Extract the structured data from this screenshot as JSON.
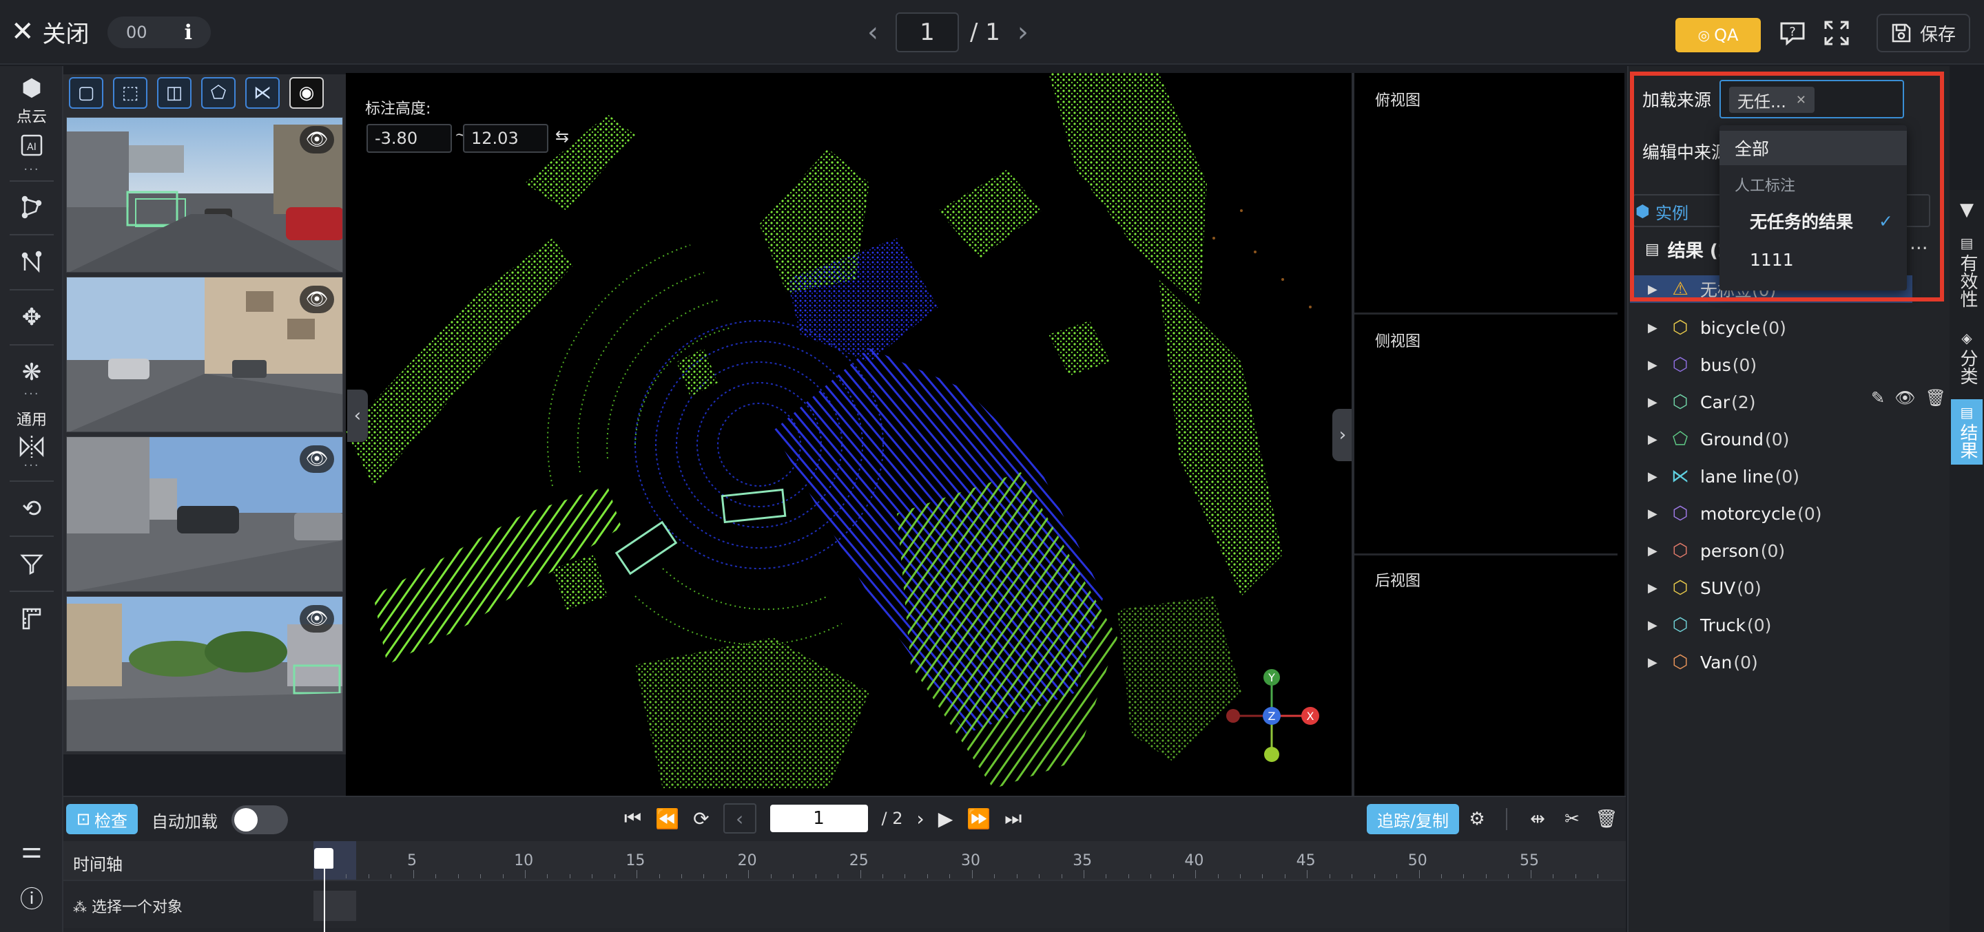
{
  "topbar": {
    "close_label": "关闭",
    "pill_count": "00",
    "page_current": "1",
    "page_total": "/ 1",
    "qa_label": "QA",
    "save_label": "保存"
  },
  "rail": {
    "section_pointcloud": "点云",
    "section_general": "通用"
  },
  "viewport": {
    "height_label": "标注高度:",
    "height_min": "-3.80",
    "height_sep": "~",
    "height_max": "12.03"
  },
  "axes": {
    "y": "Y",
    "z": "Z",
    "x": "X"
  },
  "sideviews": {
    "top": "俯视图",
    "side": "侧视图",
    "back": "后视图"
  },
  "timeline": {
    "check_label": "检查",
    "auto_load_label": "自动加载",
    "auto_load_on": false,
    "frame_current": "1",
    "frame_total": "/ 2",
    "track_copy_label": "追踪/复制",
    "axis_label": "时间轴",
    "ticks": [
      "5",
      "10",
      "15",
      "20",
      "25",
      "30",
      "35",
      "40",
      "45",
      "50",
      "55"
    ],
    "pick_object_label": "选择一个对象"
  },
  "rightpanel": {
    "load_source_label": "加载来源",
    "selected_tag": "无任...",
    "edit_source_label": "编辑中来源",
    "tab_instance": "实例",
    "result_header": "结果 (2",
    "warn_item": "无标签(0)",
    "dropdown": {
      "all": "全部",
      "group_manual": "人工标注",
      "no_task_result": "无任务的结果",
      "item_1111": "1111"
    },
    "tree": [
      {
        "name": "bicycle",
        "count": "(0)",
        "icon": "cuboid-icon",
        "color": "#e6c84a"
      },
      {
        "name": "bus",
        "count": "(0)",
        "icon": "cuboid-icon",
        "color": "#8f6fe0"
      },
      {
        "name": "Car",
        "count": "(2)",
        "icon": "cuboid-icon",
        "color": "#6fd3a6"
      },
      {
        "name": "Ground",
        "count": "(0)",
        "icon": "polygon-icon",
        "color": "#5fc986"
      },
      {
        "name": "lane line",
        "count": "(0)",
        "icon": "polyline-icon",
        "color": "#5fd0e0"
      },
      {
        "name": "motorcycle",
        "count": "(0)",
        "icon": "cuboid-icon",
        "color": "#a07ae8"
      },
      {
        "name": "person",
        "count": "(0)",
        "icon": "cuboid-icon",
        "color": "#e07a6a"
      },
      {
        "name": "SUV",
        "count": "(0)",
        "icon": "cuboid-icon",
        "color": "#e6c84a"
      },
      {
        "name": "Truck",
        "count": "(0)",
        "icon": "cuboid-icon",
        "color": "#6fd0d6"
      },
      {
        "name": "Van",
        "count": "(0)",
        "icon": "cuboid-icon",
        "color": "#e8945a"
      }
    ]
  },
  "vtabs": {
    "validity": "有效性",
    "classify": "分类",
    "result": "结果"
  },
  "colors": {
    "accent": "#59b3e8",
    "qa": "#f2b92e",
    "highlight_box": "#e43a2a",
    "points_green": "#7de83a",
    "points_blue": "#2233dd"
  }
}
